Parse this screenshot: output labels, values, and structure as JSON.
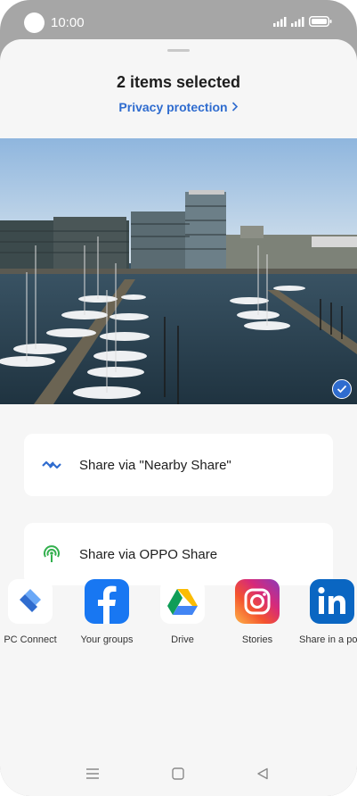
{
  "status": {
    "time": "10:00"
  },
  "sheet": {
    "title": "2 items selected",
    "privacy_link": "Privacy protection"
  },
  "share_options": [
    {
      "label": "Share via \"Nearby Share\"",
      "icon": "nearby-share-icon"
    },
    {
      "label": "Share via OPPO Share",
      "icon": "oppo-share-icon"
    }
  ],
  "apps": [
    {
      "label": "PC Connect",
      "icon": "pc-connect-icon"
    },
    {
      "label": "Your groups",
      "icon": "facebook-icon"
    },
    {
      "label": "Drive",
      "icon": "google-drive-icon"
    },
    {
      "label": "Stories",
      "icon": "instagram-icon"
    },
    {
      "label": "Share in a post",
      "icon": "linkedin-icon"
    }
  ],
  "colors": {
    "accent": "#2f6ccf",
    "sheet_bg": "#f6f6f6",
    "frame": "#a6a6a6"
  }
}
